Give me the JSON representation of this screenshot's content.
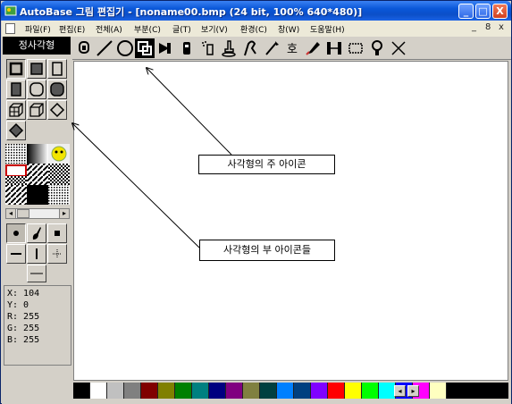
{
  "window": {
    "title": "AutoBase 그림 편집기 - [noname00.bmp (24 bit, 100% 640*480)]",
    "controls": {
      "minimize": "_",
      "maximize": "□",
      "close": "X"
    }
  },
  "menu": {
    "items": [
      "파일(F)",
      "편집(E)",
      "전체(A)",
      "부분(C)",
      "글(T)",
      "보기(V)",
      "환경(C)",
      "창(W)",
      "도움말(H)"
    ],
    "mdi_controls": [
      "_",
      "8",
      "x"
    ]
  },
  "shape_label": "정사각형",
  "toolbar": {
    "tools": [
      "stamp-icon",
      "line-icon",
      "ellipse-icon",
      "rectangle-icon",
      "fill-icon",
      "eraser-icon",
      "spray-icon",
      "airbrush-icon",
      "curve-icon",
      "brush-icon",
      "text-icon",
      "pen-icon",
      "resize-icon",
      "select-icon",
      "zoom-icon",
      "cross-icon"
    ],
    "active_tool": "rectangle-icon"
  },
  "callouts": {
    "main_icon": "사각형의 주 아이콘",
    "sub_icons": "사각형의 부 아이콘들"
  },
  "coords": {
    "x": "X: 104",
    "y": "Y: 0",
    "r": "R: 255",
    "g": "G: 255",
    "b": "B: 255"
  },
  "palette": {
    "colors": [
      "#000000",
      "#ffffff",
      "#c0c0c0",
      "#808080",
      "#800000",
      "#808000",
      "#008000",
      "#008080",
      "#000080",
      "#800080",
      "#808040",
      "#004040",
      "#0080ff",
      "#004080",
      "#8000ff",
      "#ff0000",
      "#ffff00",
      "#00ff00",
      "#00ffff",
      "#0000ff",
      "#ff00ff",
      "#ffffc0"
    ],
    "accent": "#0a57d8"
  }
}
